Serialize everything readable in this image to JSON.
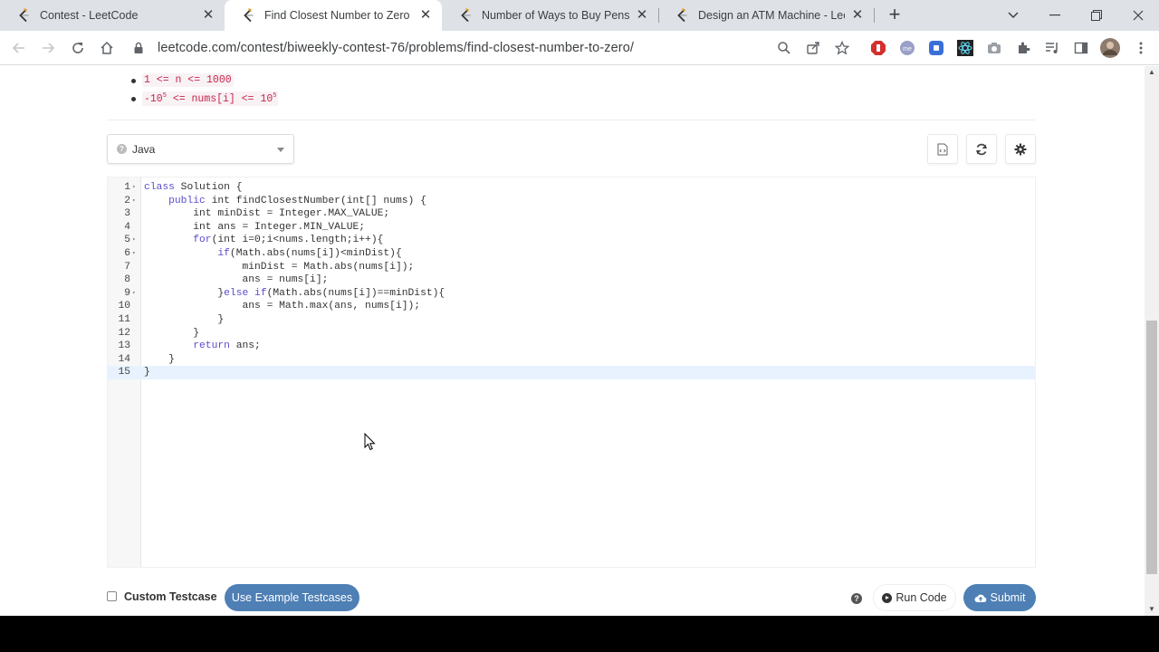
{
  "browser": {
    "tabs": [
      {
        "title": "Contest - LeetCode",
        "active": false
      },
      {
        "title": "Find Closest Number to Zero - Le",
        "active": true
      },
      {
        "title": "Number of Ways to Buy Pens and",
        "active": false
      },
      {
        "title": "Design an ATM Machine - LeetCo",
        "active": false
      }
    ],
    "new_tab_label": "+",
    "url": "leetcode.com/contest/biweekly-contest-76/problems/find-closest-number-to-zero/"
  },
  "constraints": [
    {
      "text": "1 <= n <= 1000"
    },
    {
      "prefix": "-10",
      "sup1": "5",
      "middle": " <= nums[i] <= 10",
      "sup2": "5"
    }
  ],
  "editor": {
    "language": "Java",
    "lines": [
      {
        "n": "1",
        "fold": true,
        "code": "class Solution {"
      },
      {
        "n": "2",
        "fold": true,
        "code": "    public int findClosestNumber(int[] nums) {"
      },
      {
        "n": "3",
        "fold": false,
        "code": "        int minDist = Integer.MAX_VALUE;"
      },
      {
        "n": "4",
        "fold": false,
        "code": "        int ans = Integer.MIN_VALUE;"
      },
      {
        "n": "5",
        "fold": true,
        "code": "        for(int i=0;i<nums.length;i++){"
      },
      {
        "n": "6",
        "fold": true,
        "code": "            if(Math.abs(nums[i])<minDist){"
      },
      {
        "n": "7",
        "fold": false,
        "code": "                minDist = Math.abs(nums[i]);"
      },
      {
        "n": "8",
        "fold": false,
        "code": "                ans = nums[i];"
      },
      {
        "n": "9",
        "fold": true,
        "code": "            }else if(Math.abs(nums[i])==minDist){"
      },
      {
        "n": "10",
        "fold": false,
        "code": "                ans = Math.max(ans, nums[i]);"
      },
      {
        "n": "11",
        "fold": false,
        "code": "            }"
      },
      {
        "n": "12",
        "fold": false,
        "code": "        }"
      },
      {
        "n": "13",
        "fold": false,
        "code": "        return ans;"
      },
      {
        "n": "14",
        "fold": false,
        "code": "    }"
      },
      {
        "n": "15",
        "fold": false,
        "code": "}"
      }
    ]
  },
  "footer": {
    "custom_testcase_label": "Custom Testcase",
    "example_button": "Use Example Testcases",
    "run_button": "Run Code",
    "submit_button": "Submit",
    "help_icon": "?"
  },
  "colors": {
    "accent": "#4e7fb5",
    "keyword": "#5a4dcc",
    "code_inline": "#c7254e"
  }
}
